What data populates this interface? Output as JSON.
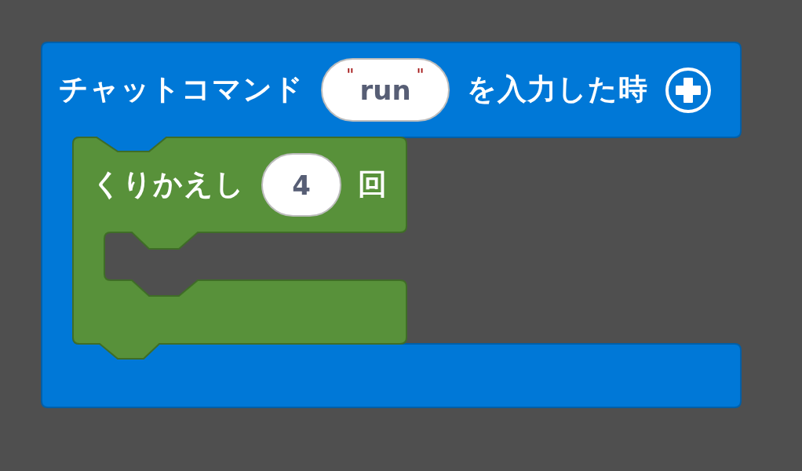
{
  "event_block": {
    "label": "チャットコマンド",
    "string_input": {
      "quote_left": "\"",
      "value": "run",
      "quote_right": "\""
    },
    "label_2": "を入力した時",
    "body": [
      {
        "kind": "repeat",
        "label": "くりかえし",
        "count_input": "4",
        "unit": "回"
      }
    ]
  }
}
